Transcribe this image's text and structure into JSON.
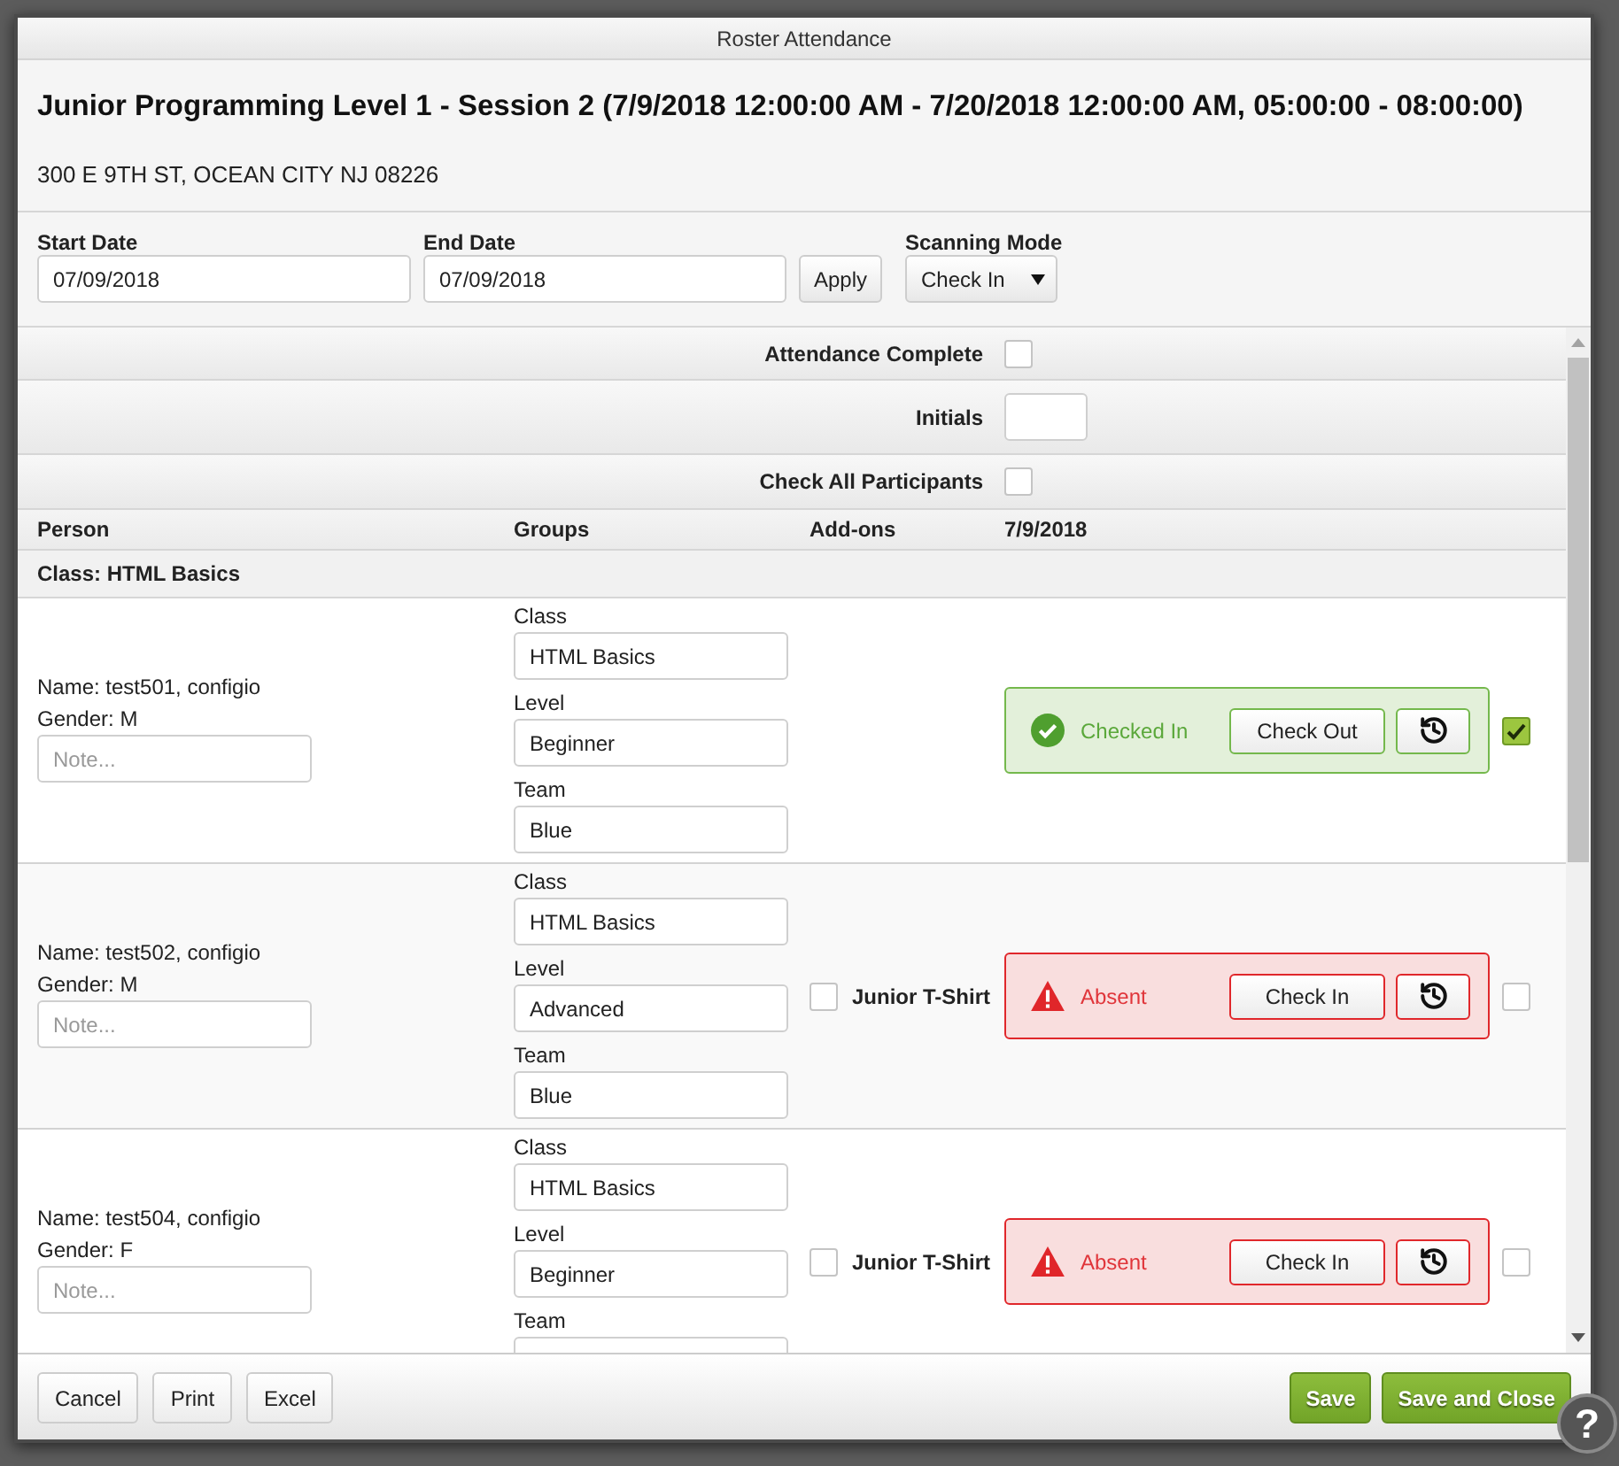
{
  "window": {
    "title": "Roster Attendance"
  },
  "heading": {
    "title": "Junior Programming Level 1 - Session 2 (7/9/2018 12:00:00 AM - 7/20/2018 12:00:00 AM, 05:00:00 - 08:00:00)",
    "address": "300 E 9TH ST, OCEAN CITY NJ 08226"
  },
  "filters": {
    "start_date": {
      "label": "Start Date",
      "value": "07/09/2018"
    },
    "end_date": {
      "label": "End Date",
      "value": "07/09/2018"
    },
    "apply_button": "Apply",
    "scanning_mode": {
      "label": "Scanning Mode",
      "value": "Check In"
    }
  },
  "options": [
    {
      "kind": "checkbox",
      "label": "Attendance Complete",
      "checked": false
    },
    {
      "kind": "input",
      "label": "Initials"
    },
    {
      "kind": "checkbox",
      "label": "Check All Participants",
      "checked": false
    }
  ],
  "table": {
    "columns": [
      "Person",
      "Groups",
      "Add-ons",
      "7/9/2018"
    ],
    "group_label": "Class: HTML Basics",
    "rows": [
      {
        "name": "Name: test501, configio",
        "gender": "Gender: M",
        "note": {
          "placeholder": "Note..."
        },
        "groups": [
          {
            "label": "Class",
            "value": "HTML Basics"
          },
          {
            "label": "Level",
            "value": "Beginner"
          },
          {
            "label": "Team",
            "value": "Blue"
          }
        ],
        "status": {
          "kind": "checked_in",
          "label": "Checked In",
          "action": "Check Out"
        },
        "checked": true
      },
      {
        "name": "Name: test502, configio",
        "gender": "Gender: M",
        "note": {
          "placeholder": "Note..."
        },
        "groups": [
          {
            "label": "Class",
            "value": "HTML Basics"
          },
          {
            "label": "Level",
            "value": "Advanced"
          },
          {
            "label": "Team",
            "value": "Blue"
          }
        ],
        "addons": [
          {
            "label": "Junior T-Shirt",
            "checked": false
          }
        ],
        "status": {
          "kind": "absent",
          "label": "Absent",
          "action": "Check In"
        },
        "checked": false
      },
      {
        "name": "Name: test504, configio",
        "gender": "Gender: F",
        "note": {
          "placeholder": "Note..."
        },
        "groups": [
          {
            "label": "Class",
            "value": "HTML Basics"
          },
          {
            "label": "Level",
            "value": "Beginner"
          },
          {
            "label": "Team"
          }
        ],
        "addons": [
          {
            "label": "Junior T-Shirt",
            "checked": false
          }
        ],
        "status": {
          "kind": "absent",
          "label": "Absent",
          "action": "Check In"
        },
        "checked": false
      }
    ]
  },
  "footer": {
    "left_buttons": [
      "Cancel",
      "Print",
      "Excel"
    ],
    "right_buttons": [
      "Save",
      "Save and Close"
    ]
  },
  "help_button": "?"
}
